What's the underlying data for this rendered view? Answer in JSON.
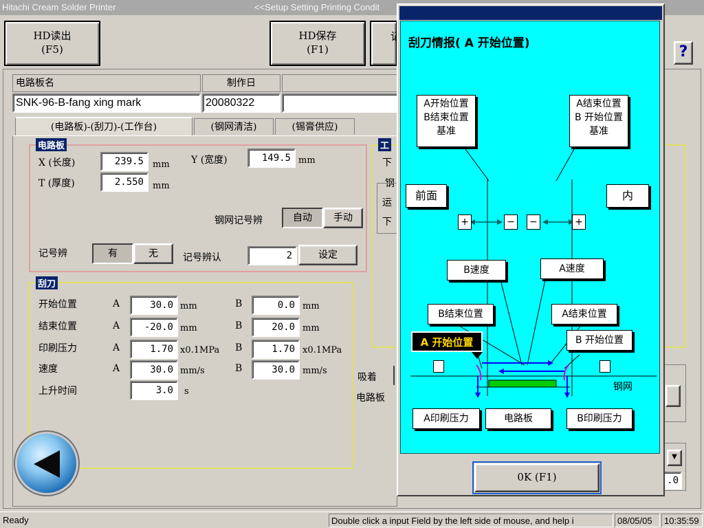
{
  "window": {
    "app_title": "Hitachi Cream Solder Printer",
    "screen_title": "<<Setup Setting Printing Condit"
  },
  "toolbar": {
    "hd_read": "HD读出",
    "hd_read_key": "(F5)",
    "hd_save": "HD保存",
    "hd_save_key": "(F1)",
    "partial_label": "记",
    "help": "?"
  },
  "board_info": {
    "name_header": "电路板名",
    "date_header": "制作日",
    "name_value": "SNK-96-B-fang xing mark",
    "date_value": "20080322"
  },
  "tabs": [
    "(电路板)-(刮刀)-(工作台)",
    "(钢网清洁)",
    "(锡膏供应)"
  ],
  "board_group": {
    "title": "电路板",
    "x_label": "X (长度)",
    "x_value": "239.5",
    "x_unit": "mm",
    "y_label": "Y (宽度)",
    "y_value": "149.5",
    "y_unit": "mm",
    "t_label": "T (厚度)",
    "t_value": "2.550",
    "t_unit": "mm",
    "stencil_mark_label": "钢网记号辨",
    "auto": "自动",
    "manual": "手动",
    "mark_label": "记号辨",
    "mark_yes": "有",
    "mark_no": "无",
    "mark_confirm_label": "记号辨认",
    "mark_confirm_value": "2",
    "set_button": "设定"
  },
  "squeegee_group": {
    "title": "刮刀",
    "rows": [
      {
        "label": "开始位置",
        "a": "A",
        "a_value": "30.0",
        "a_unit": "mm",
        "b": "B",
        "b_value": "0.0",
        "b_unit": "mm"
      },
      {
        "label": "结束位置",
        "a": "A",
        "a_value": "-20.0",
        "a_unit": "mm",
        "b": "B",
        "b_value": "20.0",
        "b_unit": "mm"
      },
      {
        "label": "印刷压力",
        "a": "A",
        "a_value": "1.70",
        "a_unit": "x0.1MPa",
        "b": "B",
        "b_value": "1.70",
        "b_unit": "x0.1MPa"
      },
      {
        "label": "速度",
        "a": "A",
        "a_value": "30.0",
        "a_unit": "mm/s",
        "b": "B",
        "b_value": "30.0",
        "b_unit": "mm/s"
      }
    ],
    "rise_label": "上升时间",
    "rise_value": "3.0",
    "rise_unit": "s"
  },
  "right_panel": {
    "title_partial": "工",
    "rows": [
      "下",
      "钢",
      "运",
      "下"
    ],
    "suction_label": "吸着",
    "board_label": "电路板",
    "partial_value": ".0"
  },
  "dialog": {
    "title": "刮刀情报( A 开始位置)",
    "label_left_top": [
      "A开始位置",
      "B结束位置",
      "基准"
    ],
    "label_right_top": [
      "A结束位置",
      "B 开始位置",
      "基准"
    ],
    "front": "前面",
    "inner": "内",
    "plus": "+",
    "minus": "−",
    "b_speed": "B速度",
    "a_speed": "A速度",
    "b_end": "B结束位置",
    "a_end": "A结束位置",
    "a_start": "A 开始位置",
    "b_start": "B 开始位置",
    "stencil": "钢网",
    "a_pressure": "A印刷压力",
    "board": "电路板",
    "b_pressure": "B印刷压力",
    "ok_button": "0K (F1)"
  },
  "status": {
    "ready": "Ready",
    "hint": "Double click a input Field by the left side of mouse, and help i",
    "date": "08/05/05",
    "time": "10:35:59"
  },
  "icons": {
    "back": "back-arrow-icon",
    "help": "help-icon"
  },
  "colors": {
    "cyan": "#00ffff",
    "highlight": "#0a246a",
    "group_border_pink": "#e0a0a0",
    "group_border_yellow": "#e0e060",
    "green_board": "#00cc00",
    "blue_arrow": "#0000ff"
  }
}
